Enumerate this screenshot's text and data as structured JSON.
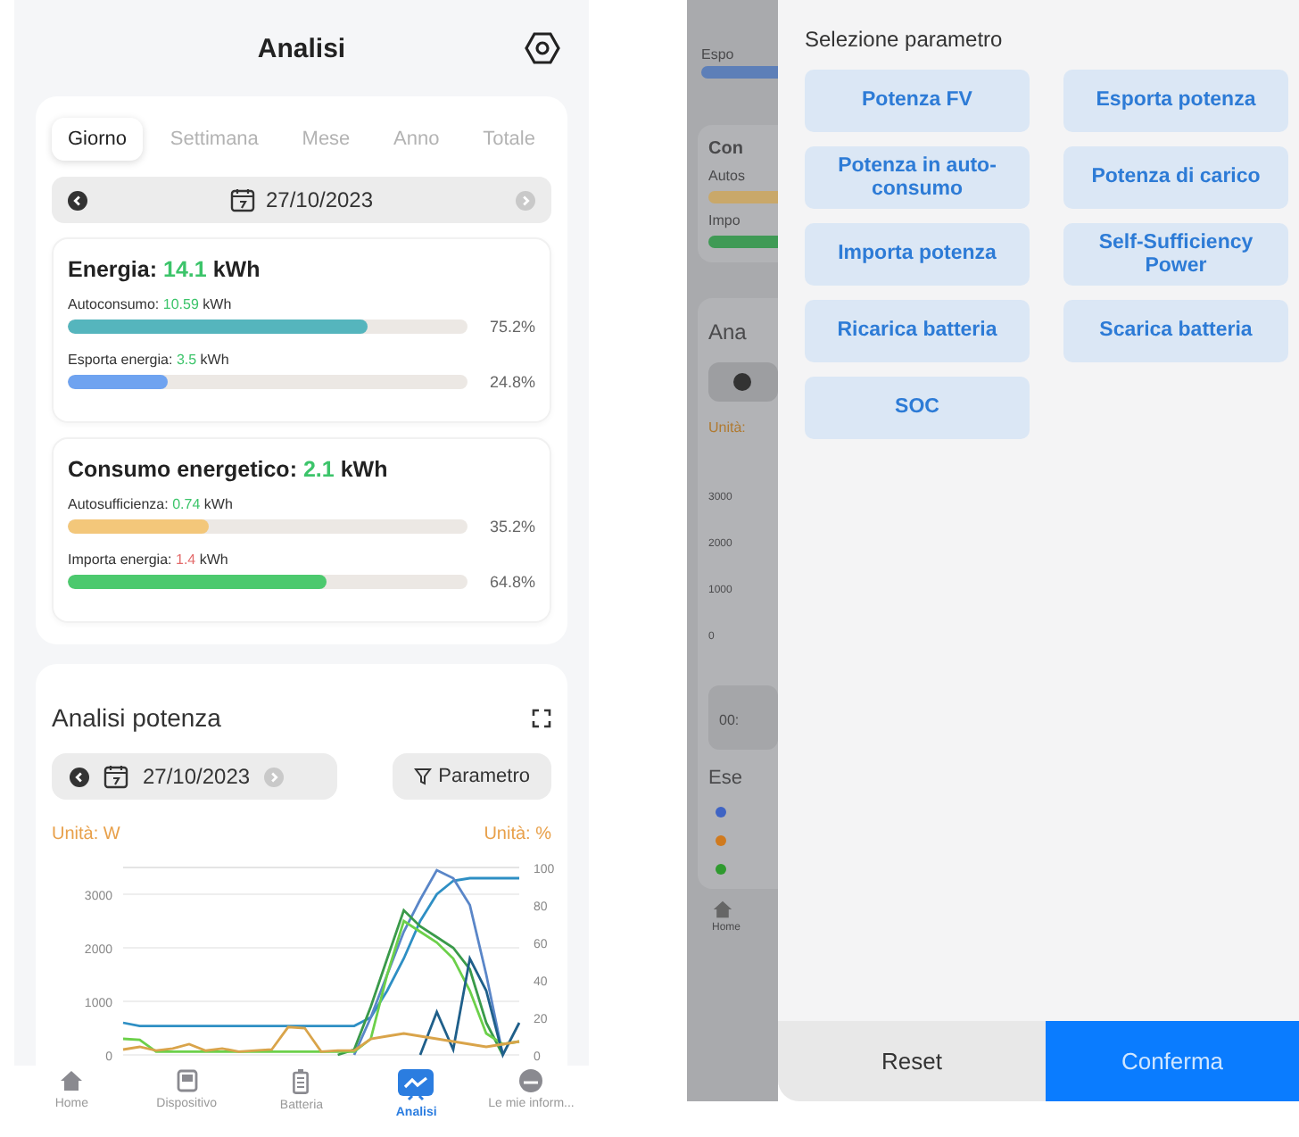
{
  "main_screen": {
    "header": {
      "title": "Analisi"
    },
    "energy_card": {
      "tabs": [
        {
          "label": "Giorno",
          "selected": true
        },
        {
          "label": "Settimana",
          "selected": false
        },
        {
          "label": "Mese",
          "selected": false
        },
        {
          "label": "Anno",
          "selected": false
        },
        {
          "label": "Totale",
          "selected": false
        }
      ],
      "date": "27/10/2023",
      "groups": [
        {
          "title": "Energia:",
          "value": "14.1",
          "unit": "kWh",
          "rows": [
            {
              "label": "Autoconsumo:",
              "value": "10.59",
              "unit": "kWh",
              "kind": "gain",
              "color": "#55b5bd",
              "level": 0.752,
              "percent": "75.2%"
            },
            {
              "label": "Esporta energia:",
              "value": "3.5",
              "unit": "kWh",
              "kind": "gain",
              "color": "#6fa3f0",
              "level": 0.248,
              "percent": "24.8%"
            }
          ]
        },
        {
          "title": "Consumo energetico:",
          "value": "2.1",
          "unit": "kWh",
          "rows": [
            {
              "label": "Autosufficienza:",
              "value": "0.74",
              "unit": "kWh",
              "kind": "gain",
              "color": "#f3c77a",
              "level": 0.352,
              "percent": "35.2%"
            },
            {
              "label": "Importa energia:",
              "value": "1.4",
              "unit": "kWh",
              "kind": "cost",
              "color": "#4cc96e",
              "level": 0.648,
              "percent": "64.8%"
            }
          ]
        }
      ]
    },
    "power_card": {
      "title": "Analisi potenza",
      "date": "27/10/2023",
      "parameter_button": "Parametro",
      "unit_left": "Unità: W",
      "unit_right": "Unità: %",
      "right_ticks": [
        "100",
        "80",
        "60",
        "40",
        "20",
        "0"
      ],
      "chart_data": {
        "type": "line",
        "grid": true,
        "ylim": [
          0,
          3500
        ],
        "yticks": [
          0,
          1000,
          2000,
          3000
        ],
        "series": [
          {
            "color": "#2e8fc4",
            "values": [
              600,
              540,
              540,
              540,
              540,
              540,
              540,
              540,
              540,
              540,
              540,
              540,
              540,
              540,
              540,
              700,
              1200,
              1800,
              2500,
              3000,
              3250,
              3300,
              3300,
              3300,
              3300
            ]
          },
          {
            "color": "#5a86c8",
            "values": [
              null,
              null,
              null,
              null,
              null,
              null,
              null,
              null,
              null,
              null,
              null,
              null,
              null,
              null,
              0,
              700,
              1500,
              2300,
              2900,
              3450,
              3300,
              2800,
              1500,
              0,
              null
            ]
          },
          {
            "color": "#3a9a4a",
            "values": [
              null,
              null,
              null,
              null,
              null,
              null,
              null,
              null,
              null,
              null,
              null,
              null,
              null,
              0,
              100,
              900,
              1800,
              2700,
              2400,
              2200,
              2000,
              1600,
              600,
              0,
              null
            ]
          },
          {
            "color": "#6cd04a",
            "values": [
              300,
              280,
              60,
              60,
              60,
              60,
              60,
              60,
              60,
              60,
              60,
              60,
              60,
              60,
              60,
              300,
              1500,
              2500,
              2300,
              2100,
              1800,
              1200,
              400,
              200,
              250
            ]
          },
          {
            "color": "#1f5f8a",
            "values": [
              null,
              null,
              null,
              null,
              null,
              null,
              null,
              null,
              null,
              null,
              null,
              null,
              null,
              null,
              null,
              null,
              null,
              null,
              0,
              800,
              100,
              1800,
              1200,
              0,
              600
            ]
          },
          {
            "color": "#d9a44a",
            "values": [
              100,
              150,
              80,
              120,
              200,
              80,
              120,
              60,
              80,
              100,
              520,
              500,
              60,
              80,
              80,
              300,
              350,
              400,
              350,
              300,
              250,
              200,
              150,
              200,
              250
            ]
          }
        ]
      }
    },
    "nav": [
      {
        "label": "Home",
        "selected": false
      },
      {
        "label": "Dispositivo",
        "selected": false
      },
      {
        "label": "Batteria",
        "selected": false
      },
      {
        "label": "Analisi",
        "selected": true
      },
      {
        "label": "Le mie inform...",
        "selected": false
      }
    ]
  },
  "parameter_screen": {
    "dimmed_page": {
      "energy_label": "Espo",
      "card_title": "Con",
      "rows": [
        {
          "label": "Autos",
          "color": "#c9a86a"
        },
        {
          "label": "Impo",
          "color": "#3f9a55"
        }
      ],
      "section_title": "Ana",
      "unit_label": "Unità:",
      "axis_ticks": [
        "3000",
        "2000",
        "1000",
        "0"
      ],
      "time_pill": "00:",
      "legend_title": "Ese",
      "legend_dots": [
        {
          "color": "#3f64c4"
        },
        {
          "color": "#d07a1e"
        },
        {
          "color": "#2f9a2f"
        }
      ],
      "nav_label": "Home"
    },
    "drawer": {
      "title": "Selezione parametro",
      "options": [
        "Potenza FV",
        "Esporta potenza",
        "Potenza in auto-consumo",
        "Potenza di carico",
        "Importa potenza",
        "Self-Sufficiency Power",
        "Ricarica batteria",
        "Scarica batteria",
        "SOC"
      ],
      "buttons": [
        {
          "label": "Reset",
          "kind": "secondary"
        },
        {
          "label": "Conferma",
          "kind": "primary"
        }
      ]
    }
  }
}
